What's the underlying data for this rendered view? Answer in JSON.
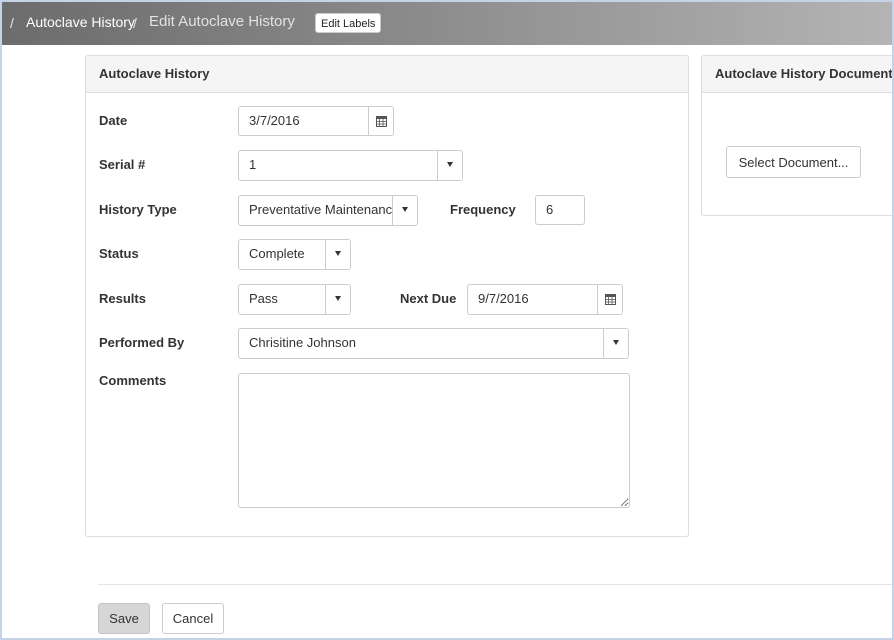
{
  "breadcrumb": {
    "separator": "/",
    "parent": "Autoclave History",
    "current": "Edit Autoclave History",
    "edit_labels": "Edit Labels"
  },
  "form": {
    "title": "Autoclave History",
    "date": {
      "label": "Date",
      "value": "3/7/2016"
    },
    "serial": {
      "label": "Serial #",
      "value": "1"
    },
    "history_type": {
      "label": "History Type",
      "value": "Preventative Maintenance"
    },
    "frequency": {
      "label": "Frequency",
      "value": "6"
    },
    "status": {
      "label": "Status",
      "value": "Complete"
    },
    "results": {
      "label": "Results",
      "value": "Pass"
    },
    "next_due": {
      "label": "Next Due",
      "value": "9/7/2016"
    },
    "performed_by": {
      "label": "Performed By",
      "value": "Chrisitine Johnson"
    },
    "comments": {
      "label": "Comments",
      "value": ""
    }
  },
  "documents": {
    "title": "Autoclave History Documents",
    "select_button": "Select Document..."
  },
  "actions": {
    "save": "Save",
    "cancel": "Cancel"
  },
  "colors": {
    "header_start": "#6c6c6c",
    "header_end": "#b4b4b4",
    "save_button_bg": "#d6d6d6",
    "panel_heading_bg": "#f5f5f5",
    "frame_border": "#c5d3e8"
  },
  "icons": {
    "calendar": "calendar-icon",
    "dropdown": "chevron-down-icon"
  }
}
